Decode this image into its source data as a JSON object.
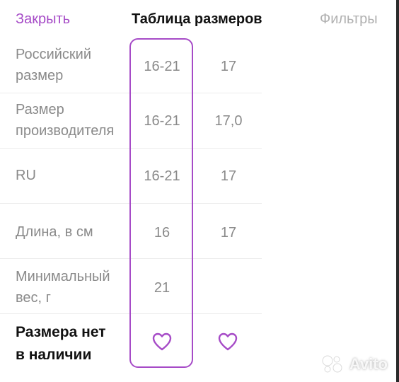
{
  "header": {
    "close_label": "Закрыть",
    "title": "Таблица размеров",
    "filters_label": "Фильтры"
  },
  "rows": [
    {
      "label_line1": "Российский",
      "label_line2": "размер",
      "col1": "16-21",
      "col2": "17"
    },
    {
      "label_line1": "Размер",
      "label_line2": "производителя",
      "col1": "16-21",
      "col2": "17,0"
    },
    {
      "label_line1": "RU",
      "label_line2": "",
      "col1": "16-21",
      "col2": "17"
    },
    {
      "label_line1": "Длина, в см",
      "label_line2": "",
      "col1": "16",
      "col2": "17"
    },
    {
      "label_line1": "Минимальный",
      "label_line2": "вес, г",
      "col1": "21",
      "col2": ""
    }
  ],
  "footer": {
    "label_line1": "Размера нет",
    "label_line2": "в наличии",
    "col1_icon": "heart-outline-icon",
    "col2_icon": "heart-outline-icon"
  },
  "watermark": {
    "text": "Avito"
  },
  "colors": {
    "accent": "#a64bc7",
    "muted": "#8a8a8a",
    "text": "#111111"
  }
}
